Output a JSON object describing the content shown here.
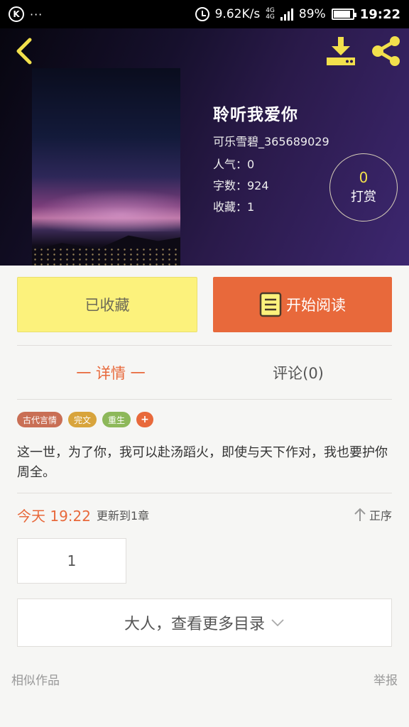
{
  "status_bar": {
    "speed": "9.62K/s",
    "network": "4G",
    "battery": "89%",
    "battery_level": 0.89,
    "time": "19:22"
  },
  "book": {
    "title": "聆听我爱你",
    "author": "可乐雪碧_365689029",
    "popularity": "人气：0",
    "words": "字数：924",
    "favorites": "收藏：1"
  },
  "tip": {
    "count": "0",
    "label": "打赏"
  },
  "actions": {
    "favorite_label": "已收藏",
    "read_label": "开始阅读"
  },
  "tabs": {
    "details": "一 详情 一",
    "comments": "评论(0)"
  },
  "tags": [
    {
      "label": "古代言情",
      "color": "#c96f55"
    },
    {
      "label": "完文",
      "color": "#d8a43c"
    },
    {
      "label": "重生",
      "color": "#8db85a"
    }
  ],
  "tag_add": "+",
  "synopsis": "这一世，为了你，我可以赴汤蹈火，即使与天下作对，我也要护你周全。",
  "update": {
    "time": "今天 19:22",
    "text": "更新到1章",
    "order_label": "正序"
  },
  "chapter": {
    "number": "1"
  },
  "toc_button": "大人，查看更多目录",
  "footer": {
    "similar": "相似作品",
    "report": "举报"
  },
  "colors": {
    "accent": "#e8693b",
    "favorite_bg": "#fcf27c",
    "icon_yellow": "#f2e04c"
  },
  "icons": [
    "back-icon",
    "download-icon",
    "share-icon",
    "book-icon",
    "arrow-up-icon",
    "chevron-down-icon"
  ]
}
